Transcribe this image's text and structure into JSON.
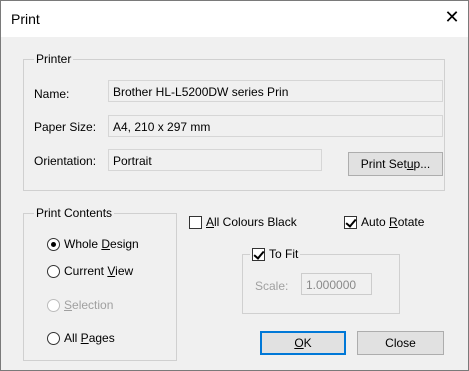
{
  "dialog": {
    "title": "Print"
  },
  "printer": {
    "group_label": "Printer",
    "name_label": "Name:",
    "name_value": "Brother HL-L5200DW series Prin",
    "paper_label": "Paper Size:",
    "paper_value": "A4, 210 x 297 mm",
    "orientation_label": "Orientation:",
    "orientation_value": "Portrait",
    "setup_button": {
      "pre": "Print Set",
      "key": "u",
      "post": "p..."
    }
  },
  "contents": {
    "group_label": "Print Contents",
    "options": [
      {
        "pre": "Whole ",
        "key": "D",
        "post": "esign",
        "selected": true,
        "enabled": true
      },
      {
        "pre": "Current ",
        "key": "V",
        "post": "iew",
        "selected": false,
        "enabled": true
      },
      {
        "pre": "",
        "key": "S",
        "post": "election",
        "selected": false,
        "enabled": false
      },
      {
        "pre": "All ",
        "key": "P",
        "post": "ages",
        "selected": false,
        "enabled": true
      }
    ]
  },
  "options": {
    "all_colours_black": {
      "pre": "",
      "key": "A",
      "post": "ll Colours Black",
      "checked": false
    },
    "auto_rotate": {
      "pre": "Auto ",
      "key": "R",
      "post": "otate",
      "checked": true
    },
    "to_fit": {
      "label": "To Fit",
      "checked": true
    },
    "scale_label": "Scale:",
    "scale_value": "1.000000"
  },
  "buttons": {
    "ok": {
      "pre": "",
      "key": "O",
      "post": "K"
    },
    "close": "Close"
  }
}
